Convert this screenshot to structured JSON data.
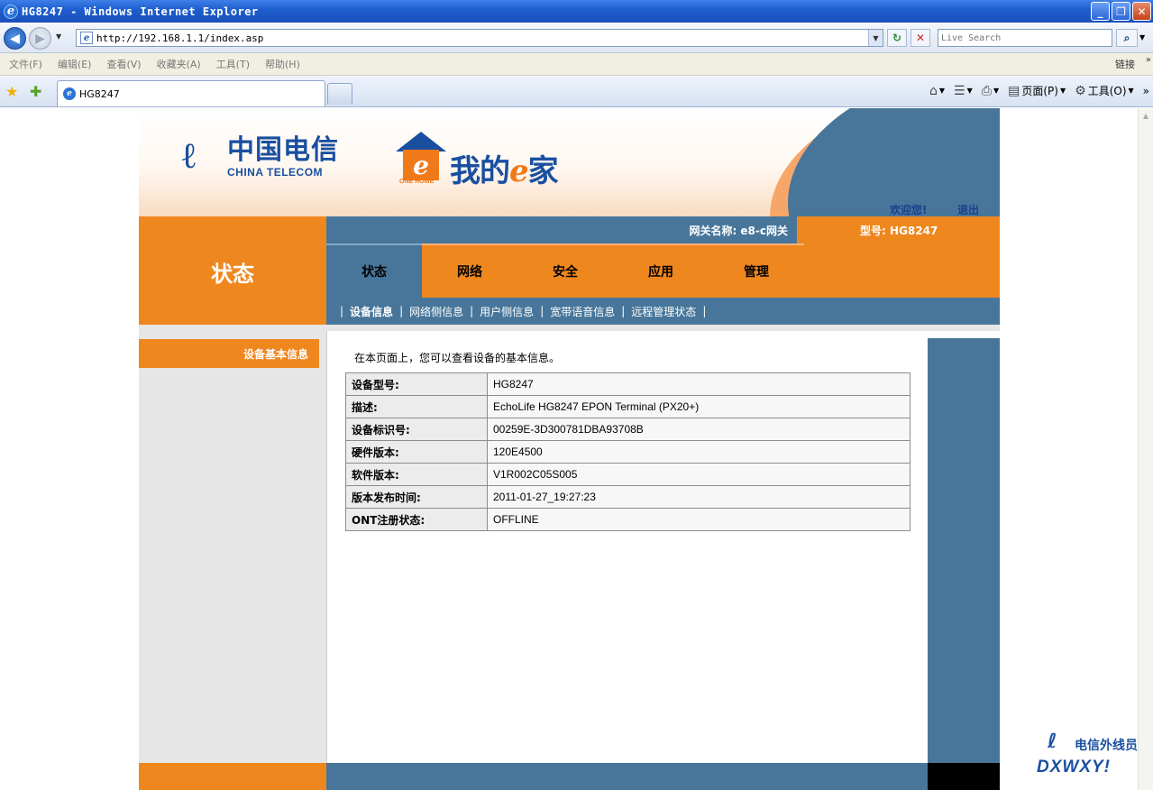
{
  "window": {
    "title": "HG8247 - Windows Internet Explorer",
    "minimize": "_",
    "maximize": "❐",
    "close": "✕"
  },
  "address": {
    "url": "http://192.168.1.1/index.asp",
    "search_placeholder": "Live Search"
  },
  "menu": {
    "items": [
      "文件(F)",
      "编辑(E)",
      "查看(V)",
      "收藏夹(A)",
      "工具(T)",
      "帮助(H)"
    ],
    "links": "链接"
  },
  "tabs": {
    "active_label": "HG8247",
    "commands": {
      "page": "页面(P)",
      "tools": "工具(O)"
    }
  },
  "router": {
    "brand_cn": "中国电信",
    "brand_en": "CHINA TELECOM",
    "ehome_sub": "ONE HOME",
    "ehome_text_a": "我的",
    "ehome_text_e": "e",
    "ehome_text_b": "家",
    "welcome": "欢迎您!",
    "logout": "退出",
    "gateway_name": "网关名称: e8-c网关",
    "model": "型号: HG8247",
    "section_title": "状态",
    "main_tabs": [
      "状态",
      "网络",
      "安全",
      "应用",
      "管理"
    ],
    "sub_nav": [
      "设备信息",
      "网络侧信息",
      "用户侧信息",
      "宽带语音信息",
      "远程管理状态"
    ],
    "sidebar_item": "设备基本信息",
    "intro": "在本页面上，您可以查看设备的基本信息。",
    "device_info": [
      {
        "label": "设备型号:",
        "value": "HG8247"
      },
      {
        "label": "描述:",
        "value": "EchoLife HG8247 EPON Terminal (PX20+)"
      },
      {
        "label": "设备标识号:",
        "value": "00259E-3D300781DBA93708B"
      },
      {
        "label": "硬件版本:",
        "value": "120E4500"
      },
      {
        "label": "软件版本:",
        "value": "V1R002C05S005"
      },
      {
        "label": "版本发布时间:",
        "value": "2011-01-27_19:27:23"
      },
      {
        "label": "ONT注册状态:",
        "value": "OFFLINE"
      }
    ]
  },
  "watermark": {
    "cn": "电信外线员",
    "en": "DXWXY!"
  },
  "colors": {
    "orange": "#ef871f",
    "steel_blue": "#47769a",
    "brand_blue": "#1a4fa0"
  }
}
